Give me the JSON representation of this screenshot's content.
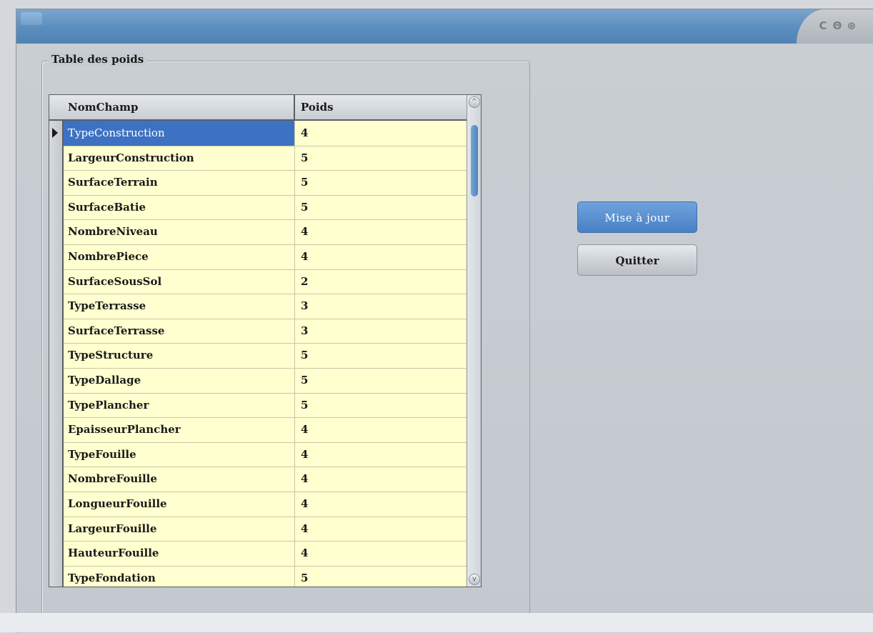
{
  "window": {
    "title": "",
    "controls": {
      "minimize": "C",
      "maximize": "Θ",
      "close": "⊗"
    }
  },
  "group": {
    "title": "Table des poids"
  },
  "table": {
    "columns": [
      "NomChamp",
      "Poids"
    ],
    "selected_row": 0,
    "rows": [
      {
        "nom": "TypeConstruction",
        "poids": "4"
      },
      {
        "nom": "LargeurConstruction",
        "poids": "5"
      },
      {
        "nom": "SurfaceTerrain",
        "poids": "5"
      },
      {
        "nom": "SurfaceBatie",
        "poids": "5"
      },
      {
        "nom": "NombreNiveau",
        "poids": "4"
      },
      {
        "nom": "NombrePiece",
        "poids": "4"
      },
      {
        "nom": "SurfaceSousSol",
        "poids": "2"
      },
      {
        "nom": "TypeTerrasse",
        "poids": "3"
      },
      {
        "nom": "SurfaceTerrasse",
        "poids": "3"
      },
      {
        "nom": "TypeStructure",
        "poids": "5"
      },
      {
        "nom": "TypeDallage",
        "poids": "5"
      },
      {
        "nom": "TypePlancher",
        "poids": "5"
      },
      {
        "nom": "EpaisseurPlancher",
        "poids": "4"
      },
      {
        "nom": "TypeFouille",
        "poids": "4"
      },
      {
        "nom": "NombreFouille",
        "poids": "4"
      },
      {
        "nom": "LongueurFouille",
        "poids": "4"
      },
      {
        "nom": "LargeurFouille",
        "poids": "4"
      },
      {
        "nom": "HauteurFouille",
        "poids": "4"
      },
      {
        "nom": "TypeFondation",
        "poids": "5"
      }
    ]
  },
  "buttons": {
    "update_label": "Mise à jour",
    "quit_label": "Quitter"
  },
  "colors": {
    "accent": "#4a80c4",
    "selection": "#3d72c2",
    "grid_bg": "#ffffd0"
  }
}
